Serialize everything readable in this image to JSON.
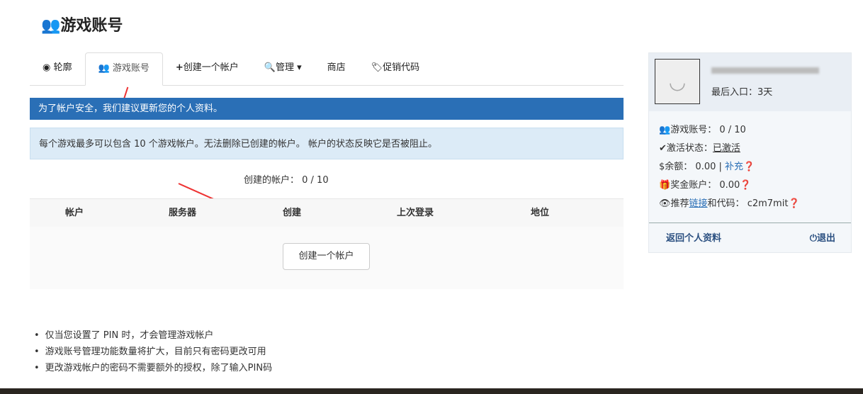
{
  "page_title": "游戏账号",
  "tabs": [
    {
      "label": "轮廓"
    },
    {
      "label": "游戏账号"
    },
    {
      "label": "创建一个帐户"
    },
    {
      "label": "管理"
    },
    {
      "label": "商店"
    },
    {
      "label": "促销代码"
    }
  ],
  "alert_primary": "为了帐户安全，我们建议更新您的个人资料。",
  "alert_info": "每个游戏最多可以包含 10 个游戏帐户。无法删除已创建的帐户。 帐户的状态反映它是否被阻止。",
  "created_accounts": "创建的帐户： 0 / 10",
  "table_headers": [
    "帐户",
    "服务器",
    "创建",
    "上次登录",
    "地位"
  ],
  "create_button": "创建一个帐户",
  "notes": [
    "仅当您设置了 PIN 时，才会管理游戏帐户",
    "游戏账号管理功能数量将扩大，目前只有密码更改可用",
    "更改游戏帐户的密码不需要额外的授权，除了输入PIN码"
  ],
  "sidebar": {
    "last_login": "最后入口：3天",
    "game_accounts_label": "游戏账号：",
    "game_accounts": "0 / 10",
    "activation_label": "激活状态：",
    "activation": "已激活",
    "balance_label": "$余额：",
    "balance": "0.00 |",
    "topup": "补充",
    "bonus_label": "奖金账户：",
    "bonus": "0.00",
    "referral_label1": "推荐",
    "referral_link": "链接",
    "referral_label2": "和代码：",
    "referral_code": "c2m7mit",
    "back": "返回个人资料",
    "logout": "退出"
  }
}
